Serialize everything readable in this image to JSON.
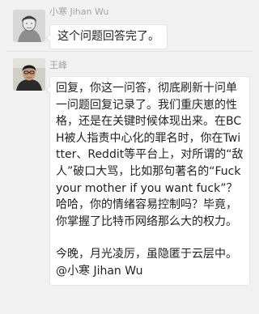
{
  "messages": [
    {
      "sender": "小寒 Jihan Wu",
      "avatar_icon": "sketch-portrait-avatar",
      "text": "这个问题回答完了。"
    },
    {
      "sender": "王峰",
      "avatar_icon": "photo-portrait-avatar",
      "paragraphs": [
        "回复，你这一问答，彻底刷新十问单一问题回复记录了。我们重庆崽的性格，还是在关键时候体现出来。在BCH被人指责中心化的罪名时，你在Twitter、Reddit等平台上，对所谓的“敌人”破口大骂，比如那句著名的“Fuck your mother if you want fuck”？哈哈，你的情绪容易控制吗？毕竟，你掌握了比特币网络那么大的权力。",
        "今晚，月光凌厉，虽隐匿于云层中。@小寒 Jihan Wu"
      ]
    }
  ],
  "colors": {
    "background": "#f1f1f1",
    "bubble": "#ffffff",
    "sender_text": "#a3a3a3",
    "message_text": "#222222"
  }
}
